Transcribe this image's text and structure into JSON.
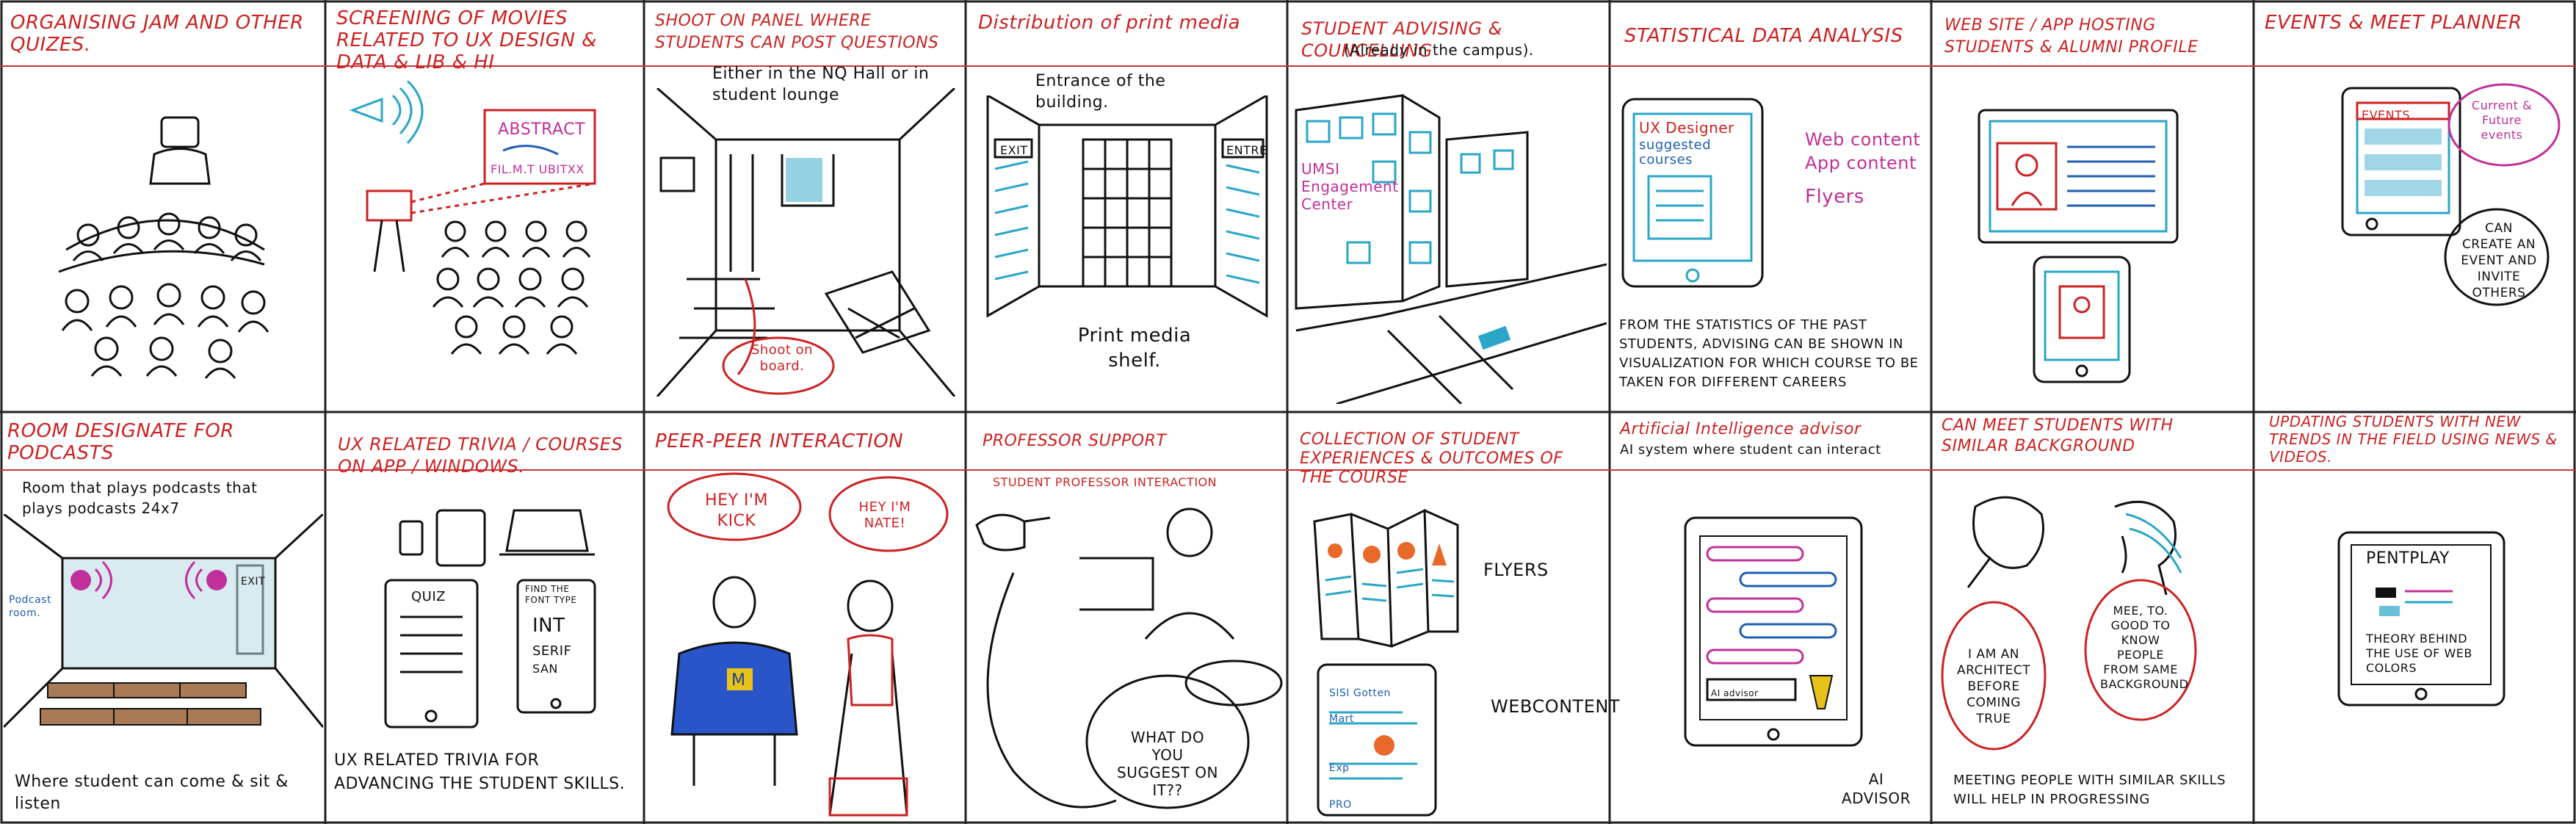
{
  "panels": [
    {
      "title": "Organising Jam and other Quizes."
    },
    {
      "title": "Screening of movies related to UX Design & Data & Lib & HI",
      "notes": {
        "board_line1": "ABSTRACT",
        "board_line2": "FIL.M.T UBITXX"
      }
    },
    {
      "title": "Shoot on panel where students can post questions",
      "notes": {
        "caption": "Either in the NQ Hall or in student lounge",
        "bubble": "Shoot on board."
      }
    },
    {
      "title": "Distribution of print media",
      "notes": {
        "caption": "Entrance of the building.",
        "sign_left": "EXIT",
        "sign_right": "ENTRE",
        "footer": "Print media shelf."
      }
    },
    {
      "title": "Student advising & councelling",
      "notes": {
        "subtitle": "(Already in the campus).",
        "building_label": "UMSI Engagement Center"
      }
    },
    {
      "title": "Statistical data analysis",
      "notes": {
        "screen_title": "UX Designer",
        "screen_sub": "suggested courses",
        "tag1": "Web content",
        "tag2": "App content",
        "tag3": "Flyers",
        "footer": "From the statistics of the past students, advising can be shown in visualization for which course to be taken for different careers"
      }
    },
    {
      "title": "Web site / app hosting students & alumni profile"
    },
    {
      "title": "Events & Meet planner",
      "notes": {
        "tab": "EVENTS",
        "bubble_top": "Current & Future events",
        "bubble_bottom": "Can create an event and invite others"
      }
    },
    {
      "title": "Room designate for podcasts",
      "notes": {
        "caption": "Room that plays podcasts that plays podcasts 24x7",
        "room_label": "Podcast room.",
        "exit": "EXIT",
        "footer": "Where student can come & sit & listen"
      }
    },
    {
      "title": "UX related trivia / courses on app / windows.",
      "notes": {
        "quiz_title": "QUIZ",
        "card2_line1": "FIND THE FONT TYPE",
        "card2_line2": "INT",
        "card2_line3": "SERIF",
        "card2_line4": "SAN",
        "footer": "UX related trivia for advancing the student skills."
      }
    },
    {
      "title": "Peer-peer interaction",
      "notes": {
        "bubble_left": "HEY I'M KICK",
        "bubble_right": "HEY I'M NATE!",
        "shirt": "M"
      }
    },
    {
      "title": "Professor support",
      "notes": {
        "subtitle": "Student professor interaction",
        "bubble": "What do you suggest on IT??"
      }
    },
    {
      "title": "Collection of student experiences & outcomes of the course",
      "notes": {
        "label1": "FLYERS",
        "label2": "WEBCONTENT",
        "phone_title": "SISI Gotten",
        "phone_line1": "Mart",
        "phone_line2": "Exp",
        "phone_line3": "PRO"
      }
    },
    {
      "title": "Artificial Intelligence advisor",
      "notes": {
        "subtitle": "AI system where student can interact",
        "footer": "AI advisor",
        "phone_label": "AI advisor"
      }
    },
    {
      "title": "Can meet students with similar background",
      "notes": {
        "bubble_left": "I am an architect before coming true",
        "bubble_right": "Mee, to. Good to know people from same background",
        "footer": "Meeting people with similar skills will help in progressing"
      }
    },
    {
      "title": "Updating students with new trends in the field using news & videos.",
      "notes": {
        "tablet_title": "PENTPLAY",
        "tablet_text": "Theory behind the use of web colors"
      }
    }
  ],
  "colors": {
    "ink": "#111111",
    "red": "#cc2222",
    "blue": "#1f5fb0",
    "cyan": "#2aa6c8",
    "magenta": "#c0309a",
    "orange": "#e8692a",
    "yellow": "#e8c21a"
  }
}
